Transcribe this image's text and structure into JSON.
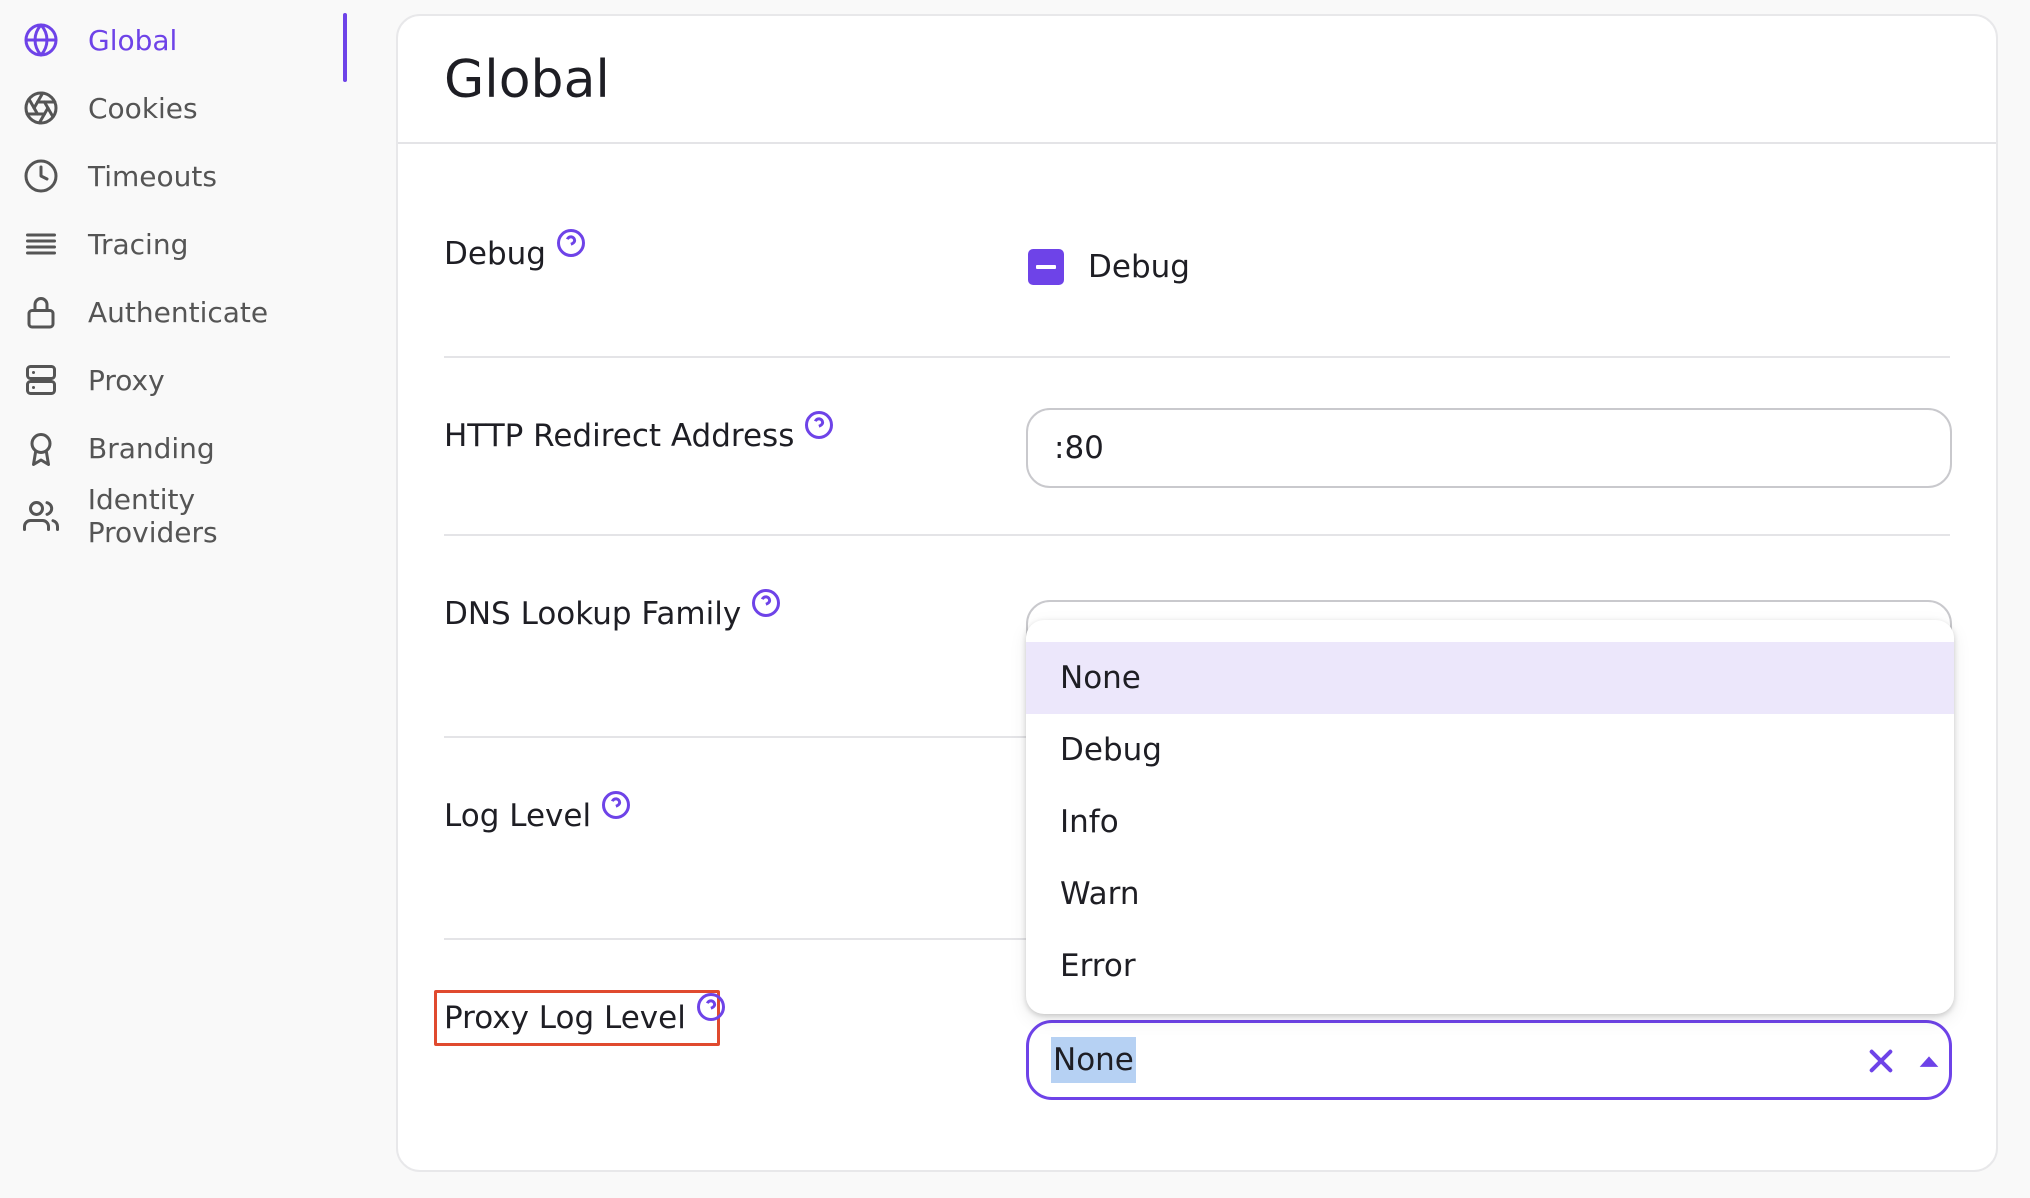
{
  "sidebar": {
    "items": [
      {
        "label": "Global",
        "icon": "globe-icon",
        "active": true
      },
      {
        "label": "Cookies",
        "icon": "aperture-icon",
        "active": false
      },
      {
        "label": "Timeouts",
        "icon": "clock-icon",
        "active": false
      },
      {
        "label": "Tracing",
        "icon": "lines-icon",
        "active": false
      },
      {
        "label": "Authenticate",
        "icon": "lock-icon",
        "active": false
      },
      {
        "label": "Proxy",
        "icon": "server-icon",
        "active": false
      },
      {
        "label": "Branding",
        "icon": "award-icon",
        "active": false
      },
      {
        "label": "Identity Providers",
        "icon": "users-icon",
        "active": false
      }
    ]
  },
  "main": {
    "title": "Global",
    "fields": {
      "debug": {
        "label": "Debug",
        "checkbox_label": "Debug",
        "checkbox_state": "indeterminate"
      },
      "http_redirect": {
        "label": "HTTP Redirect Address",
        "value": ":80"
      },
      "dns_lookup": {
        "label": "DNS Lookup Family"
      },
      "log_level": {
        "label": "Log Level"
      },
      "proxy_log_level": {
        "label": "Proxy Log Level",
        "value": "None"
      }
    },
    "dropdown": {
      "options": [
        "None",
        "Debug",
        "Info",
        "Warn",
        "Error"
      ],
      "selected": "None"
    }
  },
  "colors": {
    "accent": "#6e43e8",
    "highlight_border": "#e04a2f",
    "selected_option_bg": "#ece7fb",
    "text_selection_bg": "#b6d1f3"
  }
}
